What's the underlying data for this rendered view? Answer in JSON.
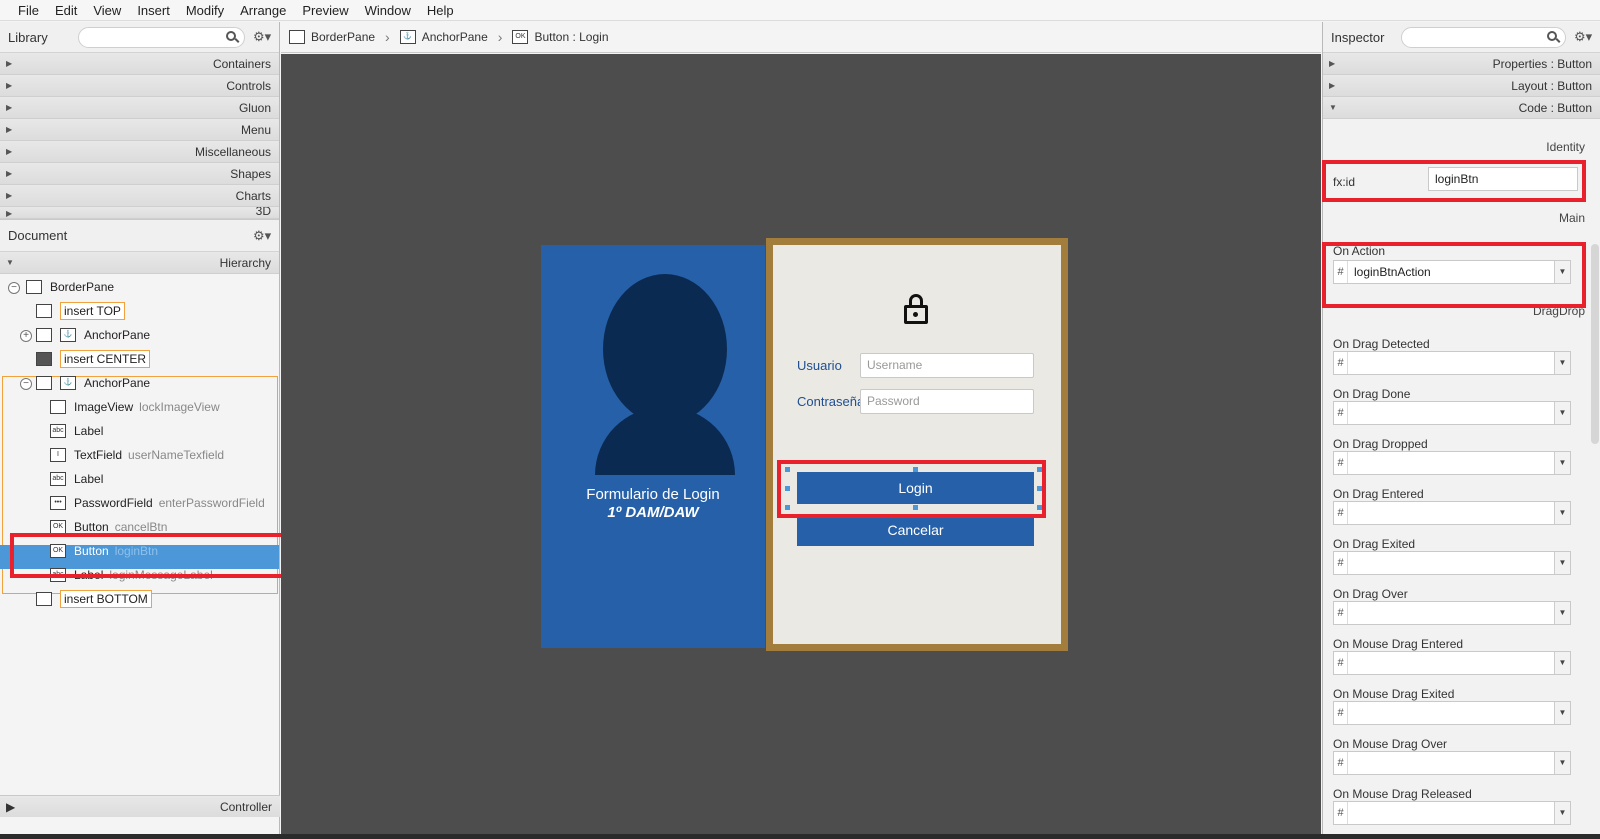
{
  "menu": [
    "File",
    "Edit",
    "View",
    "Insert",
    "Modify",
    "Arrange",
    "Preview",
    "Window",
    "Help"
  ],
  "library": {
    "title": "Library",
    "sections": [
      "Containers",
      "Controls",
      "Gluon",
      "Menu",
      "Miscellaneous",
      "Shapes",
      "Charts",
      "3D"
    ]
  },
  "document": {
    "title": "Document",
    "hierarchy_label": "Hierarchy",
    "controller_label": "Controller"
  },
  "tree": [
    {
      "type": "BorderPane",
      "id": "",
      "slot": false,
      "icon": "border-pane-icon"
    },
    {
      "type": "insert TOP",
      "id": "",
      "slot": true,
      "icon": "slot-icon"
    },
    {
      "type": "AnchorPane",
      "id": "",
      "slot": false,
      "icon": "anchor-pane-icon"
    },
    {
      "type": "insert CENTER",
      "id": "",
      "slot": true,
      "icon": "slot-icon"
    },
    {
      "type": "AnchorPane",
      "id": "",
      "slot": false,
      "icon": "anchor-pane-icon"
    },
    {
      "type": "ImageView",
      "id": "lockImageView",
      "slot": false,
      "icon": "image-view-icon"
    },
    {
      "type": "Label",
      "id": "",
      "slot": false,
      "icon": "label-icon"
    },
    {
      "type": "TextField",
      "id": "userNameTexfield",
      "slot": false,
      "icon": "text-field-icon"
    },
    {
      "type": "Label",
      "id": "",
      "slot": false,
      "icon": "label-icon"
    },
    {
      "type": "PasswordField",
      "id": "enterPasswordField",
      "slot": false,
      "icon": "password-field-icon"
    },
    {
      "type": "Button",
      "id": "cancelBtn",
      "slot": false,
      "icon": "button-icon"
    },
    {
      "type": "Button",
      "id": "loginBtn",
      "slot": false,
      "icon": "button-icon"
    },
    {
      "type": "Label",
      "id": "loginMessageLabel",
      "slot": false,
      "icon": "label-icon"
    },
    {
      "type": "insert BOTTOM",
      "id": "",
      "slot": true,
      "icon": "slot-icon"
    }
  ],
  "breadcrumb": [
    "BorderPane",
    "AnchorPane",
    "Button : Login"
  ],
  "form": {
    "title": "Formulario de Login",
    "subtitle": "1º DAM/DAW",
    "user_label": "Usuario",
    "user_placeholder": "Username",
    "pass_label": "Contraseña",
    "pass_placeholder": "Password",
    "login_label": "Login",
    "cancel_label": "Cancelar",
    "colors": {
      "blue": "#2660a8",
      "dark": "#0b2a52",
      "gold": "#a37d3c",
      "panel": "#ebe9e4"
    }
  },
  "inspector": {
    "title": "Inspector",
    "sections": [
      "Properties : Button",
      "Layout : Button",
      "Code : Button"
    ],
    "identity_label": "Identity",
    "fxid_label": "fx:id",
    "fxid_value": "loginBtn",
    "main_label": "Main",
    "on_action_label": "On Action",
    "on_action_value": "loginBtnAction",
    "dragdrop_label": "DragDrop",
    "events": [
      "On Drag Detected",
      "On Drag Done",
      "On Drag Dropped",
      "On Drag Entered",
      "On Drag Exited",
      "On Drag Over",
      "On Mouse Drag Entered",
      "On Mouse Drag Exited",
      "On Mouse Drag Over",
      "On Mouse Drag Released"
    ],
    "hash": "#"
  },
  "accent": {
    "highlight": "#e8212c",
    "selection": "#4b97d8",
    "slot_border": "#f0a33c"
  }
}
